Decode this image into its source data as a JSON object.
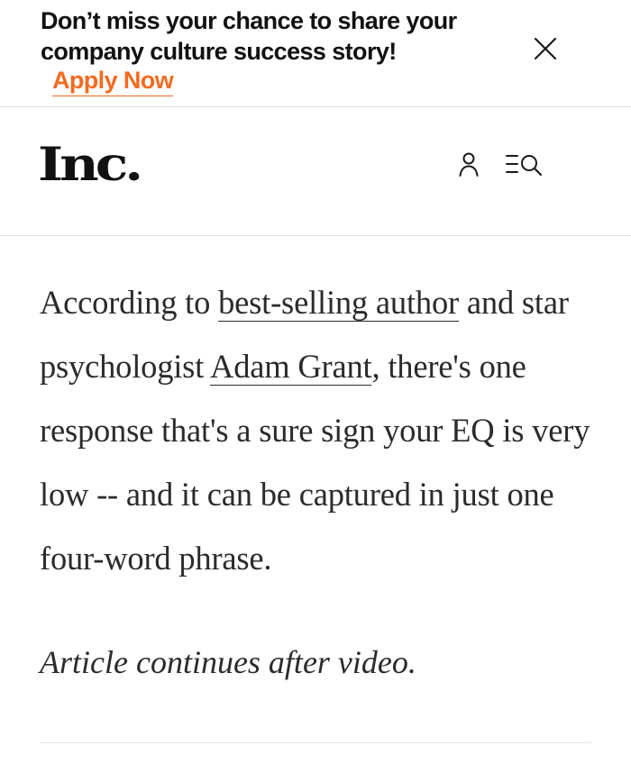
{
  "banner": {
    "message": "Don’t miss your chance to share your company culture success story!",
    "apply_label": "Apply Now",
    "close_icon": "close-icon"
  },
  "header": {
    "logo": "Inc.",
    "user_icon": "user-icon",
    "menu_search_icon": "menu-search-icon"
  },
  "article": {
    "part1": "According to ",
    "link1": "best-selling author",
    "part2": " and star psychologist ",
    "link2": "Adam Grant",
    "part3": ", there's one response that's a sure sign your EQ is very low -- and it can be captured in just one four-word phrase.",
    "continues": "Article continues after video."
  },
  "colors": {
    "accent": "#f26b21",
    "text": "#2b2b2b",
    "divider": "#e2e2e2"
  }
}
